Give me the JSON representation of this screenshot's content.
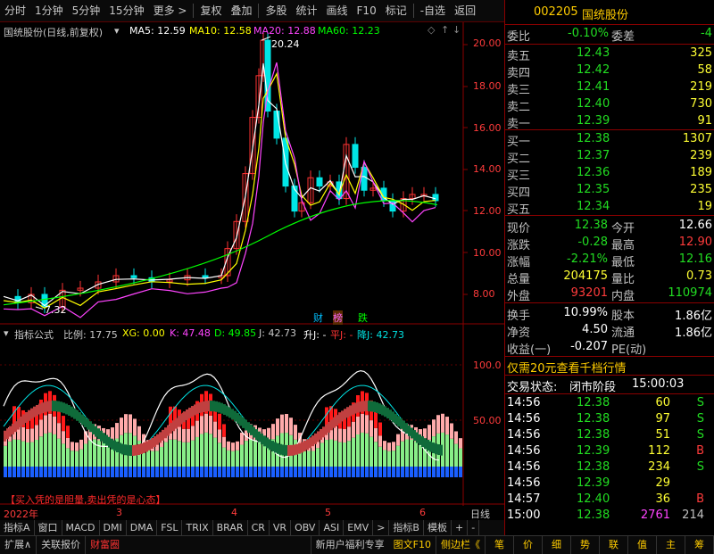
{
  "toolbar": {
    "items": [
      "分时",
      "1分钟",
      "5分钟",
      "15分钟",
      "更多 >",
      "复权",
      "叠加",
      "多股",
      "统计",
      "画线",
      "F10",
      "标记",
      "-自选",
      "返回"
    ]
  },
  "header": {
    "stock_label": "国统股份(日线,前复权)",
    "ma5": "MA5: 12.59",
    "ma10": "MA10: 12.58",
    "ma20": "MA20: 12.88",
    "ma60": "MA60: 12.23",
    "high_marker": "20.24",
    "low_marker": "7.32",
    "badges": [
      "财",
      "榜",
      "跌"
    ],
    "colors": {
      "ma5": "#ffffff",
      "ma10": "#ffff00",
      "ma20": "#ff44ff",
      "ma60": "#00ff00",
      "up": "#ff3333",
      "down": "#00ffff"
    }
  },
  "price_axis": [
    "20.00",
    "18.00",
    "16.00",
    "14.00",
    "12.00",
    "10.00",
    "8.00"
  ],
  "indicator": {
    "title": "指标公式",
    "ratio": "比例: 17.75",
    "xg": "XG: 0.00",
    "k": "K: 47.48",
    "d": "D: 49.85",
    "j": "J: 42.73",
    "up": "升J: -",
    "flat": "平J: -",
    "down": "降J: 42.73",
    "axis": [
      "100.0",
      "50.00"
    ],
    "quote": "【买入凭的是胆量,卖出凭的是心态】"
  },
  "date_axis": {
    "labels": [
      "2022年",
      "3",
      "4",
      "5",
      "6"
    ],
    "period": "日线"
  },
  "indicator_tabs": [
    "指标A",
    "窗口",
    "MACD",
    "DMI",
    "DMA",
    "FSL",
    "TRIX",
    "BRAR",
    "CR",
    "VR",
    "OBV",
    "ASI",
    "EMV",
    ">",
    "指标B",
    "模板",
    "+",
    "-"
  ],
  "status_bar": {
    "left": [
      "扩展∧",
      "关联报价",
      "财富圈"
    ],
    "news": "新用户福利专享",
    "f10": "图文F10",
    "side": "侧边栏《",
    "right_buttons": [
      "笔",
      "价",
      "细",
      "势",
      "联",
      "值",
      "主",
      "筹"
    ]
  },
  "quote_panel": {
    "code": "002205",
    "name": "国统股份",
    "weibi_label": "委比",
    "weibi": "-0.10%",
    "weicha_label": "委差",
    "weicha": "-4",
    "asks": [
      {
        "label": "卖五",
        "price": "12.43",
        "vol": "325"
      },
      {
        "label": "卖四",
        "price": "12.42",
        "vol": "58"
      },
      {
        "label": "卖三",
        "price": "12.41",
        "vol": "219"
      },
      {
        "label": "卖二",
        "price": "12.40",
        "vol": "730"
      },
      {
        "label": "卖一",
        "price": "12.39",
        "vol": "91"
      }
    ],
    "bids": [
      {
        "label": "买一",
        "price": "12.38",
        "vol": "1307"
      },
      {
        "label": "买二",
        "price": "12.37",
        "vol": "239"
      },
      {
        "label": "买三",
        "price": "12.36",
        "vol": "189"
      },
      {
        "label": "买四",
        "price": "12.35",
        "vol": "235"
      },
      {
        "label": "买五",
        "price": "12.34",
        "vol": "19"
      }
    ],
    "stats": [
      {
        "l1": "现价",
        "v1": "12.38",
        "c1": "green",
        "l2": "今开",
        "v2": "12.66",
        "c2": "white"
      },
      {
        "l1": "涨跌",
        "v1": "-0.28",
        "c1": "green",
        "l2": "最高",
        "v2": "12.90",
        "c2": "red"
      },
      {
        "l1": "涨幅",
        "v1": "-2.21%",
        "c1": "green",
        "l2": "最低",
        "v2": "12.16",
        "c2": "green"
      },
      {
        "l1": "总量",
        "v1": "204175",
        "c1": "yellow",
        "l2": "量比",
        "v2": "0.73",
        "c2": "yellow"
      },
      {
        "l1": "外盘",
        "v1": "93201",
        "c1": "red",
        "l2": "内盘",
        "v2": "110974",
        "c2": "green"
      }
    ],
    "stats2": [
      {
        "l1": "换手",
        "v1": "10.99%",
        "l2": "股本",
        "v2": "1.86亿"
      },
      {
        "l1": "净资",
        "v1": "4.50",
        "l2": "流通",
        "v2": "1.86亿"
      },
      {
        "l1": "收益(一)",
        "v1": "-0.207",
        "l2": "PE(动)",
        "v2": ""
      }
    ],
    "promo": "仅需20元查看千档行情",
    "trade_status_label": "交易状态:",
    "trade_status": "闭市阶段",
    "trade_time": "15:00:03",
    "ticks": [
      {
        "t": "14:56",
        "p": "12.38",
        "v": "60",
        "f": "S"
      },
      {
        "t": "14:56",
        "p": "12.38",
        "v": "97",
        "f": "S"
      },
      {
        "t": "14:56",
        "p": "12.38",
        "v": "51",
        "f": "S"
      },
      {
        "t": "14:56",
        "p": "12.39",
        "v": "112",
        "f": "B"
      },
      {
        "t": "14:56",
        "p": "12.38",
        "v": "234",
        "f": "S"
      },
      {
        "t": "14:56",
        "p": "12.39",
        "v": "29",
        "f": ""
      },
      {
        "t": "14:57",
        "p": "12.40",
        "v": "36",
        "f": "B"
      },
      {
        "t": "15:00",
        "p": "12.38",
        "v": "2761",
        "f": "214"
      }
    ]
  }
}
